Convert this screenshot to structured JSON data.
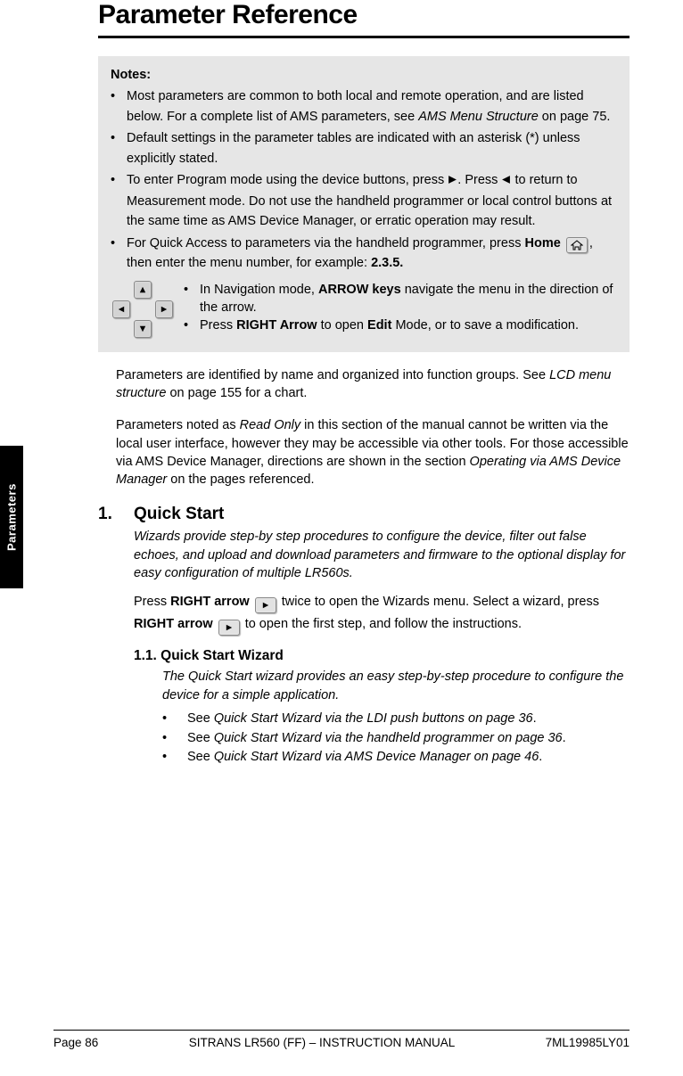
{
  "title": "Parameter Reference",
  "notes": {
    "heading": "Notes:",
    "items": [
      "Most parameters are common to both local and remote operation, and are listed below. For a complete list of AMS parameters, see ",
      "Default settings in the parameter tables are indicated with an asterisk (*) unless explicitly stated.",
      "To enter Program mode using the device buttons, press ",
      "For Quick Access to parameters via the handheld programmer, press "
    ],
    "item1_link": "AMS Menu Structure",
    "item1_tail": "  on page 75.",
    "item3_mid1": ". Press ",
    "item3_tail": " to return to Measurement mode. Do not use the handheld programmer or local control buttons at the same time as AMS Device Manager, or erratic operation may result.",
    "item4_home": "Home",
    "item4_mid": ", then enter the menu number, for example: ",
    "item4_menu": "2.3.5.",
    "nav1_a": "In Navigation mode, ",
    "nav1_b": "ARROW keys",
    "nav1_c": " navigate the menu in the direction of the arrow.",
    "nav2_a": "Press ",
    "nav2_b": "RIGHT Arrow",
    "nav2_c": " to open ",
    "nav2_d": "Edit",
    "nav2_e": " Mode, or to save a modification."
  },
  "body": {
    "p1a": "Parameters are identified by name and organized into function groups. See ",
    "p1link": "LCD menu structure",
    "p1b": "  on page 155 for a chart.",
    "p2a": "Parameters noted as ",
    "p2it": "Read Only",
    "p2b": " in this section of the manual cannot be written via the local user interface, however they may be accessible via other tools. For those accessible via AMS Device Manager, directions are shown in the section ",
    "p2it2": "Operating via AMS Device Manager",
    "p2c": " on the pages referenced."
  },
  "section1": {
    "num": "1.",
    "title": "Quick Start",
    "intro": "Wizards provide step-by step procedures to configure the device, filter out false echoes, and upload and download parameters and firmware to the optional display for easy configuration of multiple LR560s.",
    "p_a": "Press ",
    "p_b": "RIGHT arrow",
    "p_c": " twice to open the Wizards menu. Select a wizard, press ",
    "p_d": "RIGHT arrow",
    "p_e": " to open the first step, and follow the instructions."
  },
  "section11": {
    "heading": "1.1.  Quick Start Wizard",
    "intro": "The Quick Start wizard provides an easy step-by-step procedure to configure the device for a simple application.",
    "see_a": "See ",
    "see1": "Quick Start Wizard via the LDI push buttons  on page 36",
    "see2": "Quick Start Wizard via the handheld programmer  on page 36",
    "see3": "Quick Start Wizard via AMS Device Manager  on page 46",
    "dot": "."
  },
  "sidetab": "Parameters",
  "footer": {
    "left": "Page 86",
    "center": "SITRANS LR560 (FF) – INSTRUCTION MANUAL",
    "right": "7ML19985LY01"
  }
}
